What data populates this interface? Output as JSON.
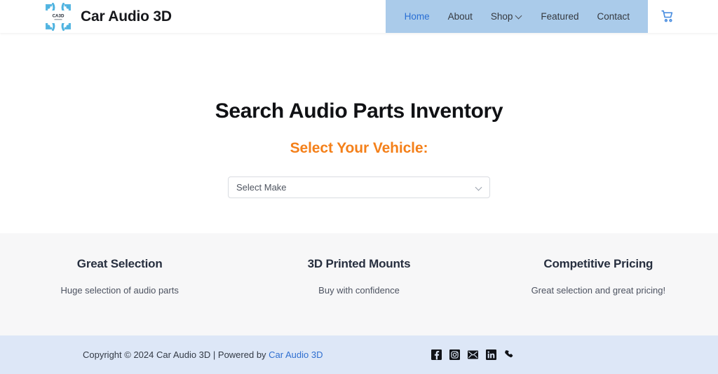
{
  "header": {
    "brand": {
      "logo_icon": "car-audio-3d-logo",
      "logo_text": "CA3D",
      "name": "Car Audio 3D"
    },
    "nav": {
      "items": [
        {
          "label": "Home",
          "active": true,
          "has_dropdown": false
        },
        {
          "label": "About",
          "active": false,
          "has_dropdown": false
        },
        {
          "label": "Shop",
          "active": false,
          "has_dropdown": true
        },
        {
          "label": "Featured",
          "active": false,
          "has_dropdown": false
        },
        {
          "label": "Contact",
          "active": false,
          "has_dropdown": false
        }
      ],
      "highlight_color": "#aacbea",
      "active_color": "#2a6fd4"
    },
    "cart": {
      "icon": "shopping-cart-icon",
      "color": "#4a8ee0"
    }
  },
  "hero": {
    "title": "Search Audio Parts Inventory",
    "subtitle": "Select Your Vehicle:",
    "subtitle_color": "#f4801a",
    "select": {
      "value": "Select Make",
      "placeholder": "Select Make",
      "options": [
        "Select Make"
      ],
      "chevron_icon": "chevron-down-icon"
    }
  },
  "features": {
    "background": "#f7f7f8",
    "items": [
      {
        "title": "Great Selection",
        "text": "Huge selection of audio parts"
      },
      {
        "title": "3D Printed Mounts",
        "text": "Buy with confidence"
      },
      {
        "title": "Competitive Pricing",
        "text": "Great selection and great pricing!"
      }
    ]
  },
  "footer": {
    "background": "#dde7f7",
    "copyright_prefix": "Copyright © 2024 Car Audio 3D | Powered by ",
    "copyright_link": "Car Audio 3D",
    "link_color": "#2f6fd0",
    "social": [
      {
        "name": "facebook",
        "icon": "facebook-icon"
      },
      {
        "name": "instagram",
        "icon": "instagram-icon"
      },
      {
        "name": "email",
        "icon": "email-icon"
      },
      {
        "name": "linkedin",
        "icon": "linkedin-icon"
      },
      {
        "name": "phone",
        "icon": "phone-icon"
      }
    ]
  }
}
